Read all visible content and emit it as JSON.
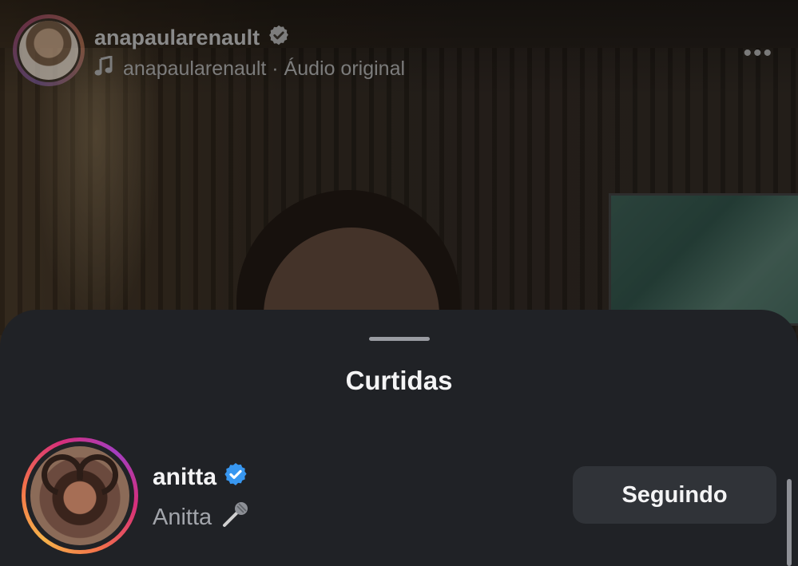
{
  "reel": {
    "username": "anapaularenault",
    "audio_text": "anapaularenault · Áudio original",
    "more_label": "•••"
  },
  "sheet": {
    "title": "Curtidas",
    "likes": [
      {
        "username": "anitta",
        "display_name": "Anitta",
        "button_label": "Seguindo",
        "verified": true
      }
    ]
  },
  "colors": {
    "verified_badge": "#3897f0",
    "sheet_background": "#202226",
    "button_background": "#303338"
  }
}
